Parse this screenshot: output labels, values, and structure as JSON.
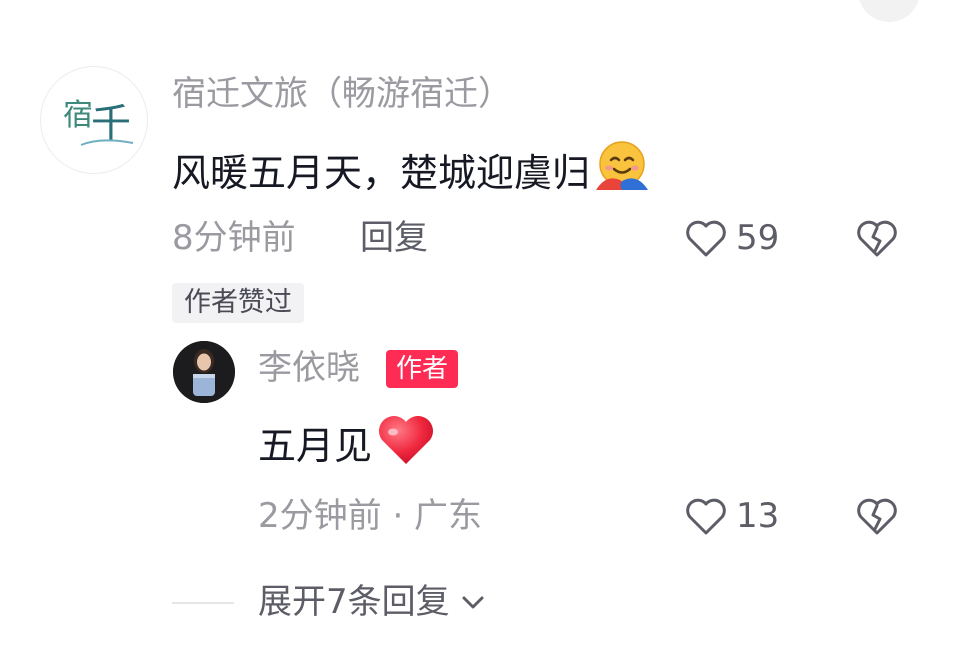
{
  "comment": {
    "author_name": "宿迁文旅（畅游宿迁）",
    "avatar_text": "宿迁",
    "text": "风暖五月天，楚城迎虞归",
    "emoji": "hugging-face",
    "time": "8分钟前",
    "reply_label": "回复",
    "like_count": "59",
    "liked_by_author_label": "作者赞过"
  },
  "reply": {
    "author_name": "李依晓",
    "author_badge": "作者",
    "text": "五月见",
    "emoji": "red-heart",
    "time": "2分钟前 · 广东",
    "like_count": "13"
  },
  "expand": {
    "label": "展开7条回复"
  },
  "colors": {
    "badge_red": "#fe2c55",
    "muted_text": "#9a9aa0",
    "secondary_text": "#5c5d66",
    "primary_text": "#161823"
  }
}
